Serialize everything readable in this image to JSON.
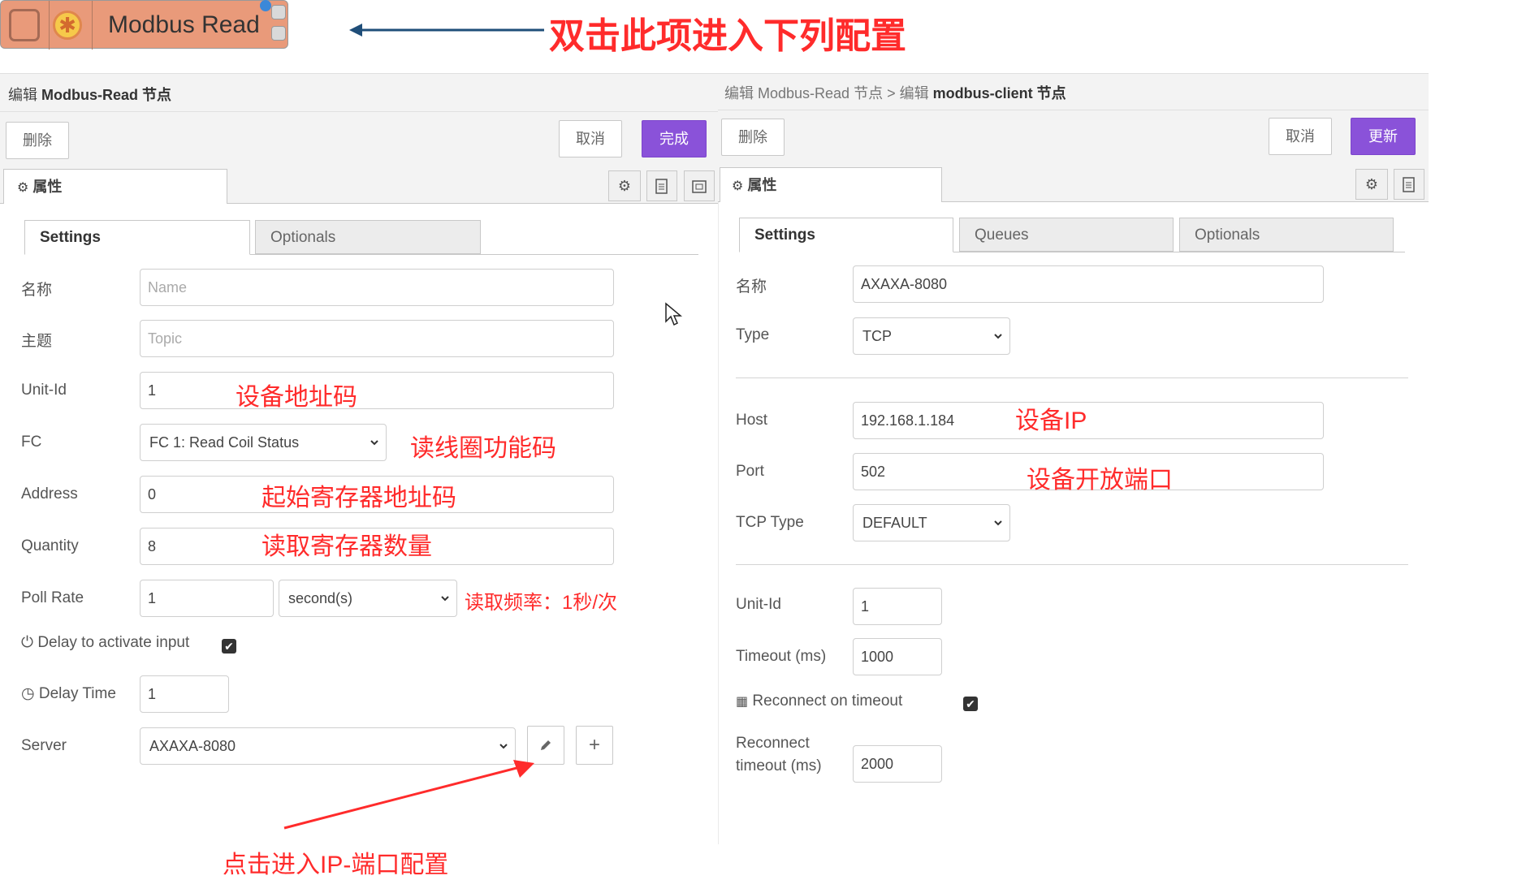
{
  "node": {
    "label": "Modbus Read"
  },
  "annotations": {
    "top": "双击此项进入下列配置",
    "unit_id": "设备地址码",
    "fc": "读线圈功能码",
    "address": "起始寄存器地址码",
    "quantity": "读取寄存器数量",
    "poll_rate": "读取频率：1秒/次",
    "server": "点击进入IP-端口配置",
    "host": "设备IP",
    "port": "设备开放端口"
  },
  "colors": {
    "accent": "#8a52d9",
    "annotation": "#ff2b2b",
    "node": "#e99a7a"
  },
  "left": {
    "title_prefix": "编辑 ",
    "title_bold": "Modbus-Read 节点",
    "delete_label": "删除",
    "cancel_label": "取消",
    "done_label": "完成",
    "properties_tab": "属性",
    "tabs": [
      "Settings",
      "Optionals"
    ],
    "fields": {
      "name": {
        "label": "名称",
        "placeholder": "Name"
      },
      "topic": {
        "label": "主题",
        "placeholder": "Topic"
      },
      "unit_id": {
        "label": "Unit-Id",
        "value": "1"
      },
      "fc": {
        "label": "FC",
        "value": "FC 1: Read Coil Status"
      },
      "address": {
        "label": "Address",
        "value": "0"
      },
      "quantity": {
        "label": "Quantity",
        "value": "8"
      },
      "poll_rate": {
        "label": "Poll Rate",
        "value": "1",
        "unit": "second(s)"
      },
      "delay_activate": {
        "label": "Delay to activate input",
        "checked": true
      },
      "delay_time": {
        "label": "Delay Time",
        "value": "1"
      },
      "server": {
        "label": "Server",
        "value": "AXAXA-8080"
      }
    }
  },
  "right": {
    "title_prefix": "编辑 Modbus-Read 节点 > 编辑 ",
    "title_bold": "modbus-client 节点",
    "delete_label": "删除",
    "cancel_label": "取消",
    "update_label": "更新",
    "properties_tab": "属性",
    "tabs": [
      "Settings",
      "Queues",
      "Optionals"
    ],
    "fields": {
      "name": {
        "label": "名称",
        "value": "AXAXA-8080"
      },
      "type": {
        "label": "Type",
        "value": "TCP"
      },
      "host": {
        "label": "Host",
        "value": "192.168.1.184"
      },
      "port": {
        "label": "Port",
        "value": "502"
      },
      "tcp_type": {
        "label": "TCP Type",
        "value": "DEFAULT"
      },
      "unit_id": {
        "label": "Unit-Id",
        "value": "1"
      },
      "timeout": {
        "label": "Timeout (ms)",
        "value": "1000"
      },
      "reconnect_on_timeout": {
        "label": "Reconnect on timeout",
        "checked": true
      },
      "reconnect_timeout": {
        "label_line1": "Reconnect",
        "label_line2": "timeout (ms)",
        "value": "2000"
      }
    }
  }
}
